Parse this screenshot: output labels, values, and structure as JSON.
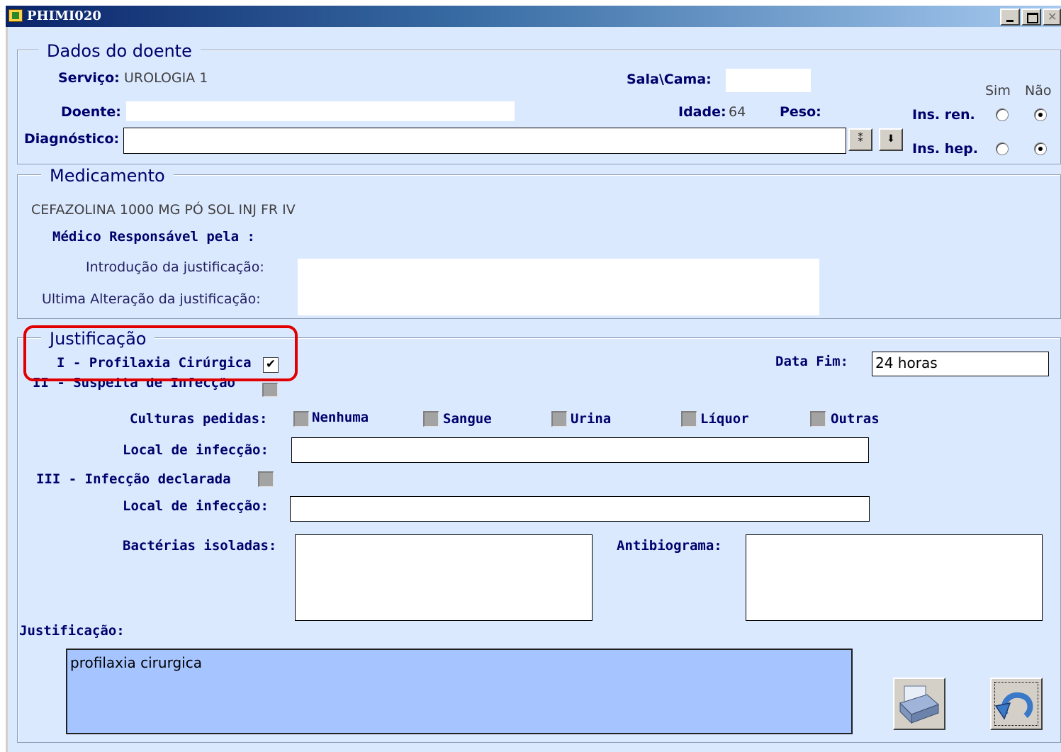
{
  "window": {
    "title": "PHIMI020"
  },
  "dados": {
    "legend": "Dados do doente",
    "servico_label": "Serviço:",
    "servico_value": "UROLOGIA 1",
    "sala_label": "Sala\\Cama:",
    "sala_value": "",
    "doente_label": "Doente:",
    "doente_value": "",
    "idade_label": "Idade:",
    "idade_value": "64",
    "peso_label": "Peso:",
    "diagnostico_label": "Diagnóstico:",
    "diagnostico_value": "",
    "sim_label": "Sim",
    "nao_label": "Não",
    "ins_ren_label": "Ins. ren.",
    "ins_hep_label": "Ins. hep."
  },
  "medicamento": {
    "legend": "Medicamento",
    "name": "CEFAZOLINA 1000 MG PÓ SOL INJ FR IV",
    "medico_label": "Médico Responsável pela :",
    "introducao_label": "Introdução da justificação:",
    "ultima_label": "Ultima Alteração da justificação:"
  },
  "justificacao": {
    "legend": "Justificação",
    "profilaxia_label": "I - Profilaxia Cirúrgica",
    "profilaxia_checked": true,
    "suspeita_label": "II - Suspeita de Infecção",
    "data_fim_label": "Data Fim:",
    "data_fim_value": "24 horas",
    "culturas_label": "Culturas pedidas:",
    "culturas": [
      "Nenhuma",
      "Sangue",
      "Urina",
      "Líquor",
      "Outras"
    ],
    "local_label": "Local de infecção:",
    "local_value": "",
    "declarada_label": "III - Infecção declarada",
    "local2_label": "Local de infecção:",
    "local2_value": "",
    "bacterias_label": "Bactérias isoladas:",
    "antibiograma_label": "Antibiograma:",
    "justificacao_label": "Justificação:",
    "justificacao_text": "profilaxia cirurgica"
  },
  "colors": {
    "highlight": "#e00000",
    "panel": "#dbe9ff",
    "label": "#00006b",
    "textarea": "#a6c4ff"
  }
}
